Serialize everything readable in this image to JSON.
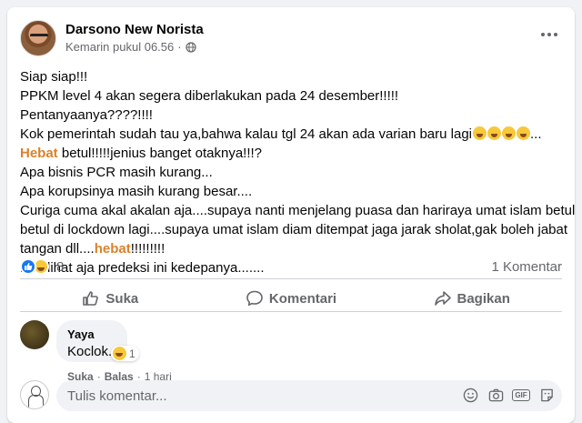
{
  "post": {
    "author": "Darsono New Norista",
    "timestamp": "Kemarin pukul 06.56",
    "privacy_icon": "globe-icon",
    "lines": [
      "Siap siap!!!",
      "PPKM level 4 akan segera diberlakukan pada 24 desember!!!!!",
      "Pentanyaanya????!!!!",
      "Kok pemerintah sudah tau ya,bahwa kalau tgl 24 akan ada varian baru lagi"
    ],
    "line4_suffix": "...",
    "hebat1": "Hebat",
    "line5_rest": " betul!!!!!jenius banget otaknya!!!?",
    "lines_b": [
      "Apa bisnis PCR masih kurang...",
      "Apa korupsinya masih kurang besar....",
      "Curiga cuma akal akalan aja....supaya nanti menjelang puasa dan hariraya umat islam betul",
      "betul di lockdown lagi....supaya umat islam diam ditempat jaga jarak sholat,gak boleh jabat"
    ],
    "line_tangan_prefix": "tangan dll....",
    "hebat2": "hebat",
    "line_tangan_suffix": "!!!!!!!!!",
    "last_line": "Kita lihat aja predeksi ini kedepanya.......",
    "reaction_count": "8",
    "comment_count": "1 Komentar"
  },
  "actions": {
    "like": "Suka",
    "comment": "Komentari",
    "share": "Bagikan"
  },
  "comment": {
    "author": "Yaya",
    "text": "Koclok..",
    "reaction_count": "1",
    "like": "Suka",
    "reply": "Balas",
    "separator": "·",
    "age": "1 hari"
  },
  "compose": {
    "placeholder": "Tulis komentar..."
  },
  "colors": {
    "accent": "#1877f2",
    "highlight": "#d9822b",
    "muted": "#65676b"
  }
}
